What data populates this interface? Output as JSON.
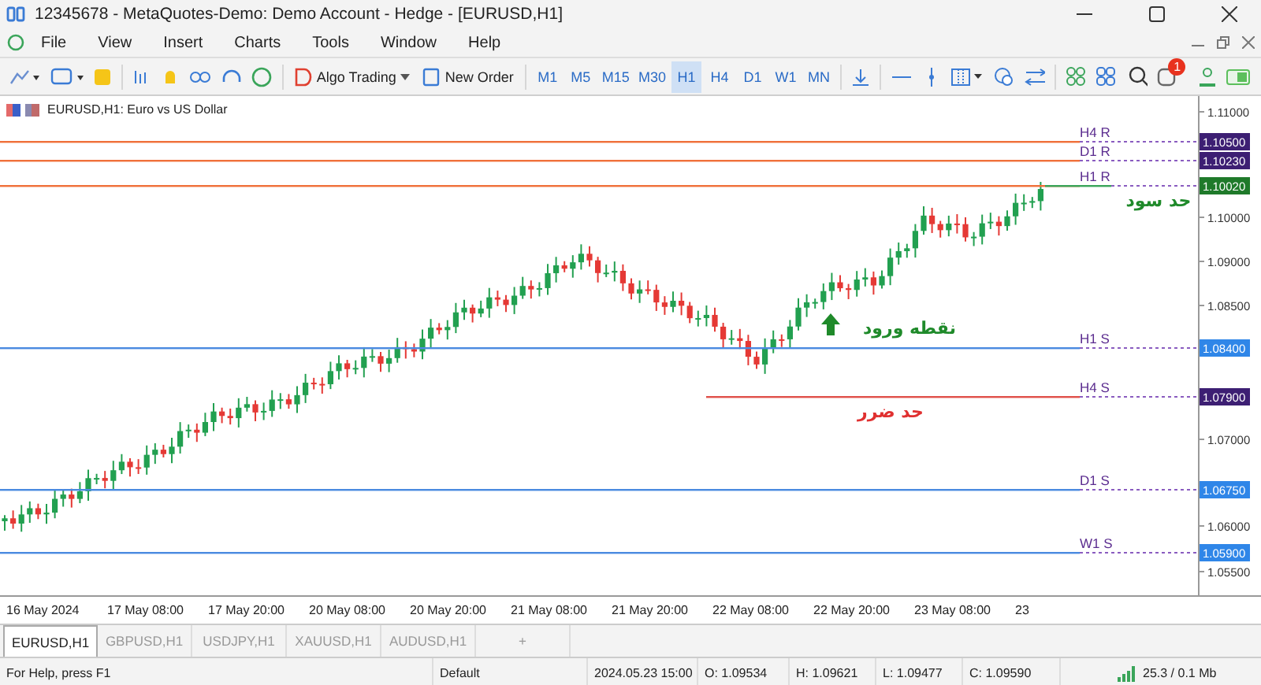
{
  "window": {
    "title": "12345678 - MetaQuotes-Demo: Demo Account - Hedge - [EURUSD,H1]"
  },
  "menu": [
    "File",
    "View",
    "Insert",
    "Charts",
    "Tools",
    "Window",
    "Help"
  ],
  "toolbar": {
    "algo_trading": "Algo Trading",
    "new_order": "New Order",
    "timeframes": [
      {
        "label": "M1",
        "selected": false
      },
      {
        "label": "M5",
        "selected": false
      },
      {
        "label": "M15",
        "selected": false
      },
      {
        "label": "M30",
        "selected": false
      },
      {
        "label": "H1",
        "selected": true
      },
      {
        "label": "H4",
        "selected": false
      },
      {
        "label": "D1",
        "selected": false
      },
      {
        "label": "W1",
        "selected": false
      },
      {
        "label": "MN",
        "selected": false
      }
    ],
    "notification_count": "1"
  },
  "chart": {
    "title": "EURUSD,H1:  Euro vs US Dollar",
    "price_ticks": [
      "1.11000",
      "1.10000",
      "1.09000",
      "1.08500",
      "1.07000",
      "1.06000",
      "1.05500"
    ],
    "levels": [
      {
        "label": "H4 R",
        "color": "#f0703a",
        "full": true,
        "tag": {
          "price": "1.10500",
          "color": "#3d1f73"
        }
      },
      {
        "label": "D1 R",
        "color": "#f0703a",
        "full": true,
        "tag": {
          "price": "1.10230",
          "color": "#3d1f73"
        }
      },
      {
        "label": "H1 R",
        "color": "#f0703a",
        "full": true,
        "tag": {
          "price": "1.10020",
          "color": "#1f7a2a"
        }
      },
      {
        "label": "H1 S",
        "color": "#4a8ae0",
        "full": true,
        "tag": {
          "price": "1.08400",
          "color": "#2f86e8"
        }
      },
      {
        "label": "H4 S",
        "color": "#e0504a",
        "full": false,
        "tag": {
          "price": "1.07900",
          "color": "#3d1f73"
        }
      },
      {
        "label": "D1 S",
        "color": "#4a8ae0",
        "full": true,
        "tag": {
          "price": "1.06750",
          "color": "#2f86e8"
        }
      },
      {
        "label": "W1 S",
        "color": "#4a8ae0",
        "full": true,
        "tag": {
          "price": "1.05900",
          "color": "#2f86e8"
        }
      }
    ],
    "annotations": [
      {
        "text": "حد سود",
        "color": "#1f8a2a",
        "kind": "label"
      },
      {
        "text": "نقطه ورود",
        "color": "#1f8a2a",
        "kind": "arrow"
      },
      {
        "text": "حد ضرر",
        "color": "#e03030",
        "kind": "label"
      }
    ],
    "time_labels": [
      "16 May 2024",
      "17 May 08:00",
      "17 May 20:00",
      "20 May 08:00",
      "20 May 20:00",
      "21 May 08:00",
      "21 May 20:00",
      "22 May 08:00",
      "22 May 20:00",
      "23 May 08:00",
      "23"
    ]
  },
  "tabs": [
    {
      "label": "EURUSD,H1",
      "selected": true
    },
    {
      "label": "GBPUSD,H1",
      "selected": false
    },
    {
      "label": "USDJPY,H1",
      "selected": false
    },
    {
      "label": "XAUUSD,H1",
      "selected": false
    },
    {
      "label": "AUDUSD,H1",
      "selected": false
    },
    {
      "label": "+",
      "selected": false
    }
  ],
  "status_bar": [
    "For Help, press F1",
    "Default",
    "2024.05.23 15:00",
    "O: 1.09534",
    "H: 1.09621",
    "L: 1.09477",
    "C: 1.09590",
    "25.3 / 0.1 Mb"
  ]
}
